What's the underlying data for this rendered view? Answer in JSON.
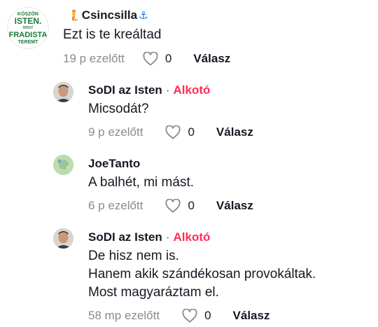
{
  "comments": [
    {
      "user": "Csincsilla",
      "name_prefix_emoji": "🧜",
      "name_suffix_emoji": "⚓",
      "is_creator": false,
      "avatar": {
        "kind": "badge",
        "text_lines": [
          "KÖSZÖN",
          "ISTEN.",
          "HOGY",
          "FRADISTA",
          "TEREMT"
        ]
      },
      "text_lines": [
        "Ezt is te kreáltad"
      ],
      "time": "19 p ezelőtt",
      "likes": "0",
      "reply_label": "Válasz"
    },
    {
      "user": "SoDI az Isten",
      "separator": "·",
      "creator_label": "Alkotó",
      "is_creator": true,
      "avatar": {
        "kind": "person"
      },
      "text_lines": [
        "Micsodát?"
      ],
      "time": "9 p ezelőtt",
      "likes": "0",
      "reply_label": "Válasz"
    },
    {
      "user": "JoeTanto",
      "is_creator": false,
      "avatar": {
        "kind": "green"
      },
      "text_lines": [
        "A balhét, mi mást."
      ],
      "time": "6 p ezelőtt",
      "likes": "0",
      "reply_label": "Válasz"
    },
    {
      "user": "SoDI az Isten",
      "separator": "·",
      "creator_label": "Alkotó",
      "is_creator": true,
      "avatar": {
        "kind": "person"
      },
      "text_lines": [
        "De hisz nem is.",
        "Hanem akik szándékosan provokáltak.",
        "Most magyaráztam el."
      ],
      "time": "58 mp ezelőtt",
      "likes": "0",
      "reply_label": "Válasz"
    }
  ]
}
